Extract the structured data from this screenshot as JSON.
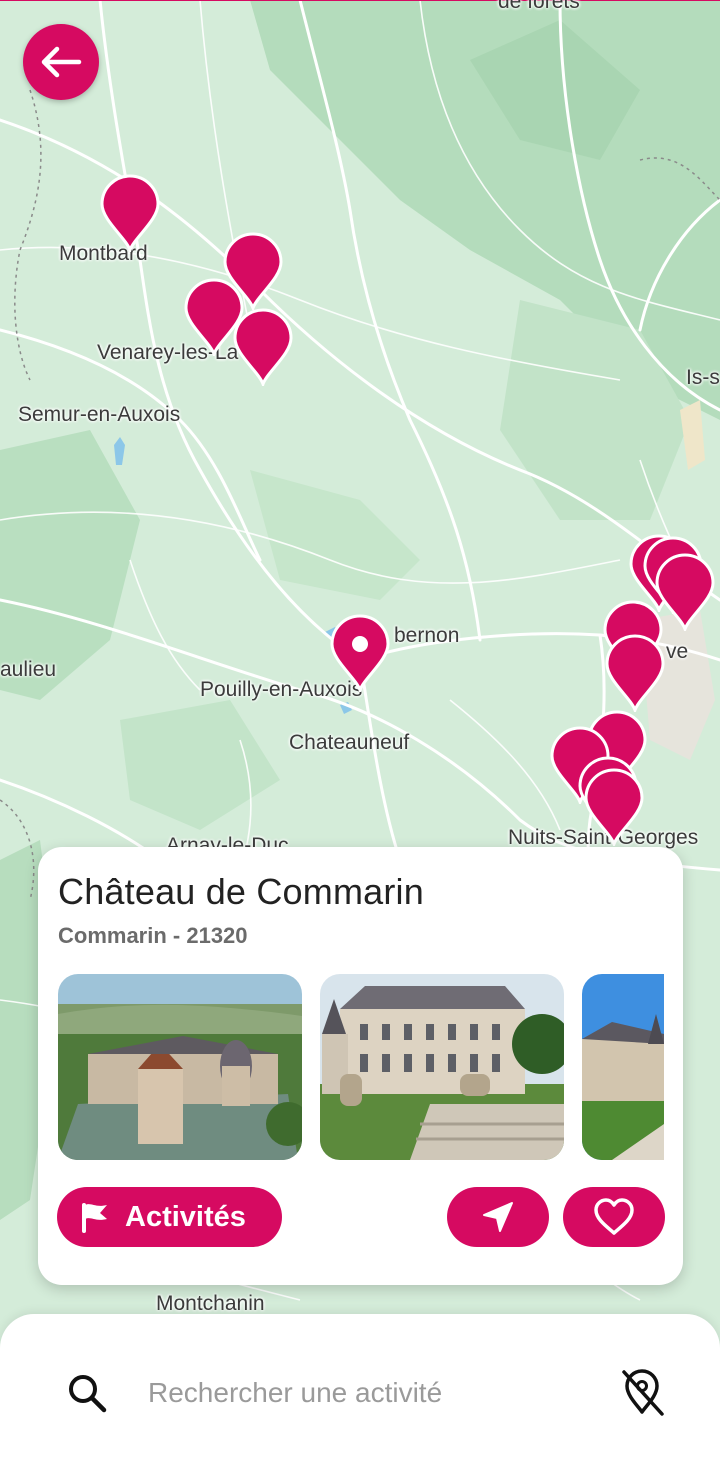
{
  "map": {
    "places": [
      {
        "id": "montbard",
        "label": "Montbard"
      },
      {
        "id": "venarey",
        "label": "Venarey-les-La"
      },
      {
        "id": "semur",
        "label": "Semur-en-Auxois"
      },
      {
        "id": "issur",
        "label": "Is-s"
      },
      {
        "id": "sombernon",
        "label": "bernon"
      },
      {
        "id": "saulieu",
        "label": "aulieu"
      },
      {
        "id": "pouilly",
        "label": "Pouilly-en-Auxois"
      },
      {
        "id": "chateauneuf",
        "label": "Chateauneuf"
      },
      {
        "id": "dijon",
        "label": "ve"
      },
      {
        "id": "nuits",
        "label": "Nuits-Saint-Georges"
      },
      {
        "id": "arnay",
        "label": "Arnay-le-Duc"
      },
      {
        "id": "forets",
        "label": "de forêts"
      },
      {
        "id": "montchanin",
        "label": "Montchanin"
      }
    ],
    "pin_color": "#d60a61"
  },
  "back_button": {
    "icon": "arrow-left-icon"
  },
  "card": {
    "title": "Château de Commarin",
    "subtitle": "Commarin - 21320",
    "activities_label": "Activités",
    "activities_icon": "flag-icon",
    "navigate_icon": "navigation-arrow-icon",
    "favorite_icon": "heart-icon"
  },
  "search": {
    "placeholder": "Rechercher une activité",
    "search_icon": "search-icon",
    "location_off_icon": "location-off-icon"
  }
}
